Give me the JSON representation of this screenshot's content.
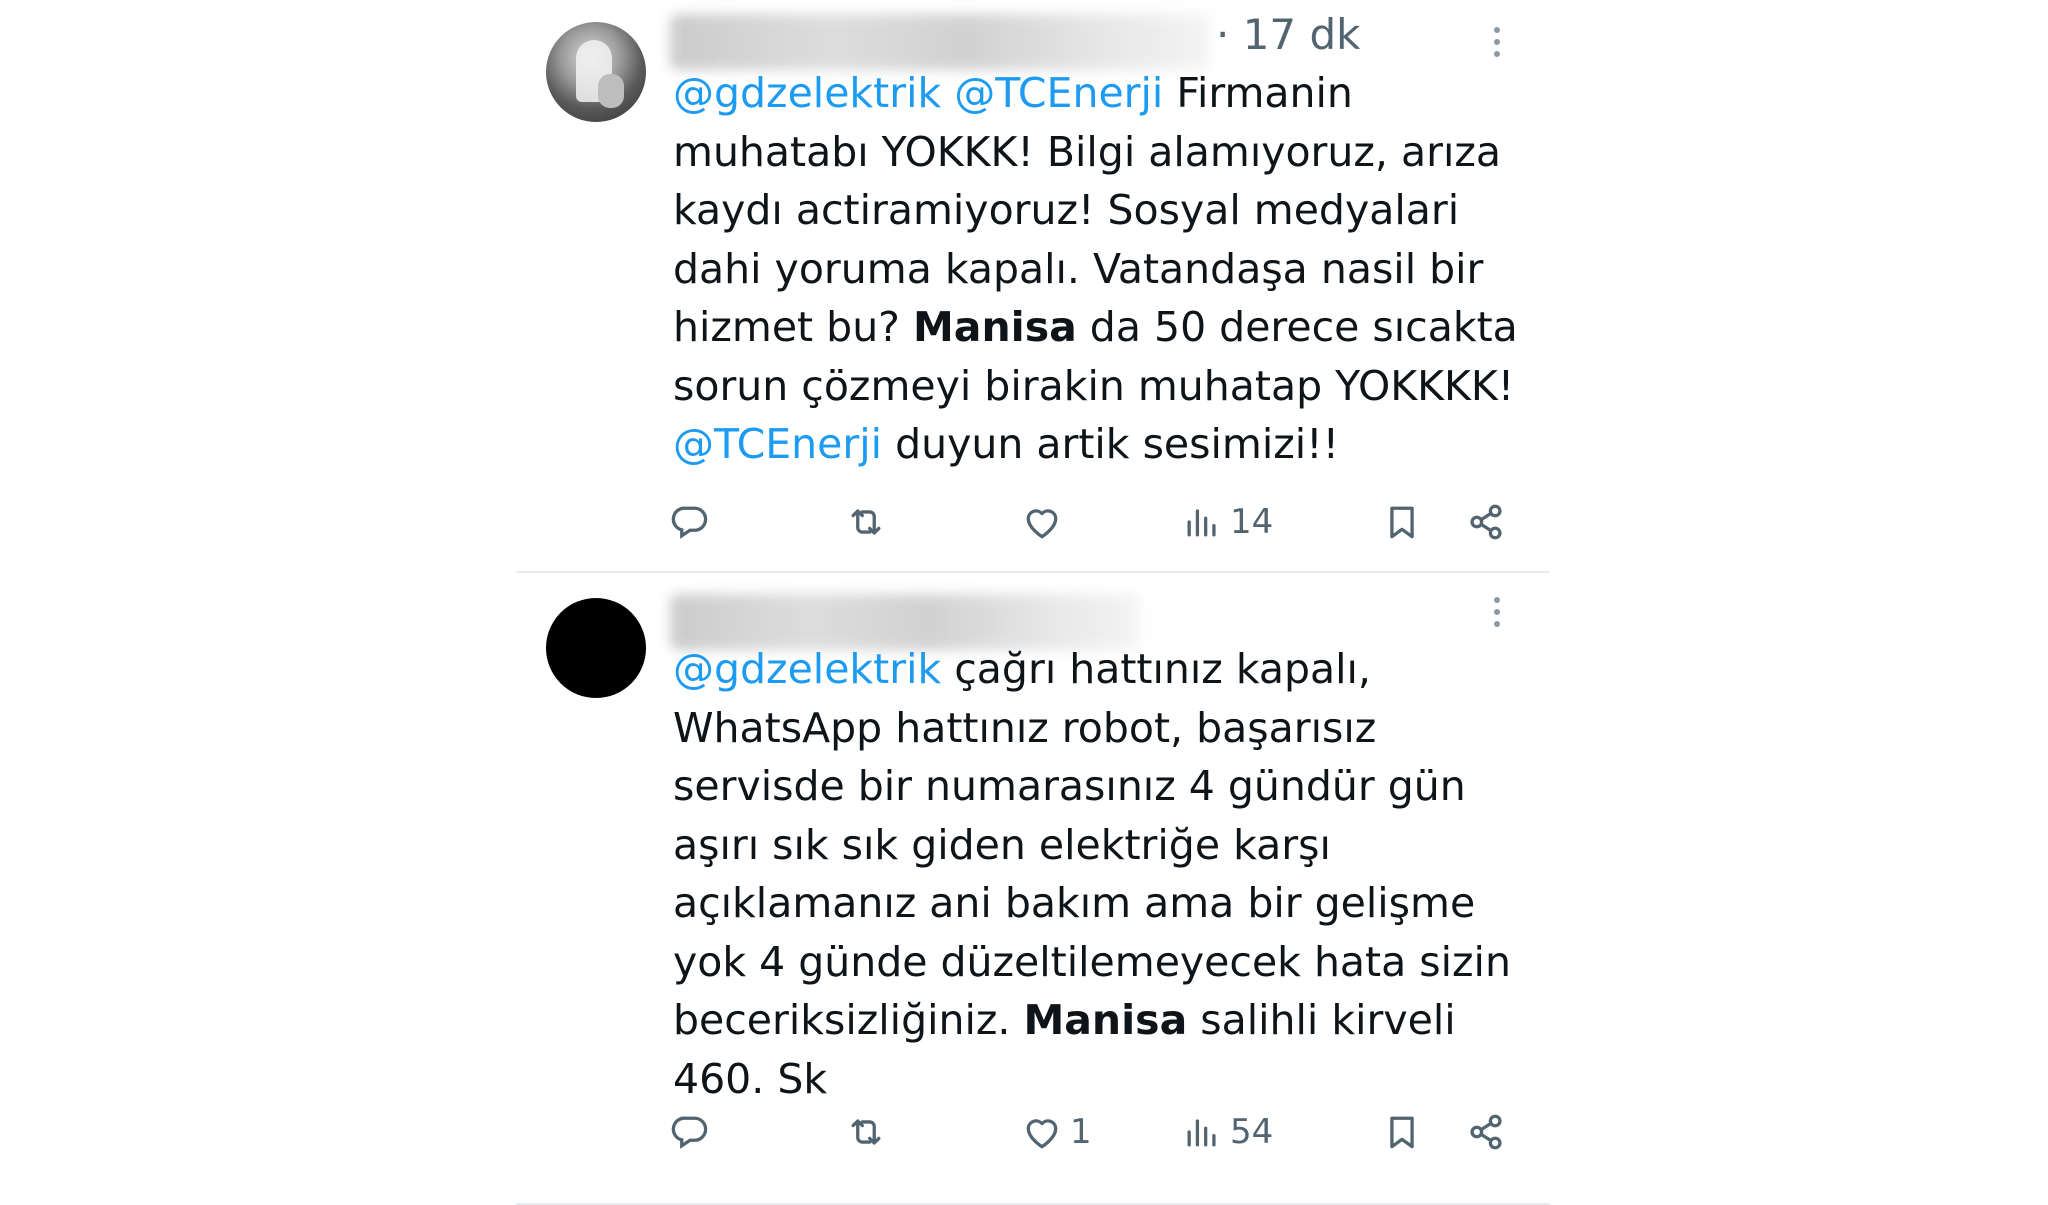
{
  "tweets": [
    {
      "time": "· 17 dk",
      "content": [
        {
          "t": "@gdzelektrik",
          "s": "mention"
        },
        {
          "t": " ",
          "s": "plain"
        },
        {
          "t": "@TCEnerji",
          "s": "mention"
        },
        {
          "t": " Firmanin muhatabı YOKKK! Bilgi alamıyoruz, arıza kaydı actiramiyoruz! Sosyal medyalari dahi yoruma kapalı. Vatandaşa nasil bir hizmet bu? ",
          "s": "plain"
        },
        {
          "t": "Manisa",
          "s": "bold"
        },
        {
          "t": " da 50 derece sıcakta sorun çözmeyi birakin muhatap YOKKKK! ",
          "s": "plain"
        },
        {
          "t": "@TCEnerji",
          "s": "mention"
        },
        {
          "t": " duyun artik sesimizi!!",
          "s": "plain"
        }
      ],
      "likes": "",
      "views": "14"
    },
    {
      "time": "",
      "content": [
        {
          "t": "@gdzelektrik",
          "s": "mention"
        },
        {
          "t": " çağrı hattınız kapalı, WhatsApp hattınız robot, başarısız servisde bir numarasınız 4 gündür gün aşırı sık sık giden elektriğe karşı açıklamanız ani bakım ama bir gelişme yok 4 günde düzeltilemeyecek hata sizin beceriksizliğiniz. ",
          "s": "plain"
        },
        {
          "t": "Manisa",
          "s": "bold"
        },
        {
          "t": " salihli kirveli 460. Sk",
          "s": "plain"
        }
      ],
      "likes": "1",
      "views": "54"
    }
  ],
  "icons": {
    "reply": "reply-icon",
    "retweet": "retweet-icon",
    "like": "heart-icon",
    "views": "views-icon",
    "bookmark": "bookmark-icon",
    "share": "share-icon",
    "more": "more-icon"
  },
  "colors": {
    "mention": "#1d9bf0",
    "icon": "#536471",
    "divider": "#e6ecf0"
  }
}
